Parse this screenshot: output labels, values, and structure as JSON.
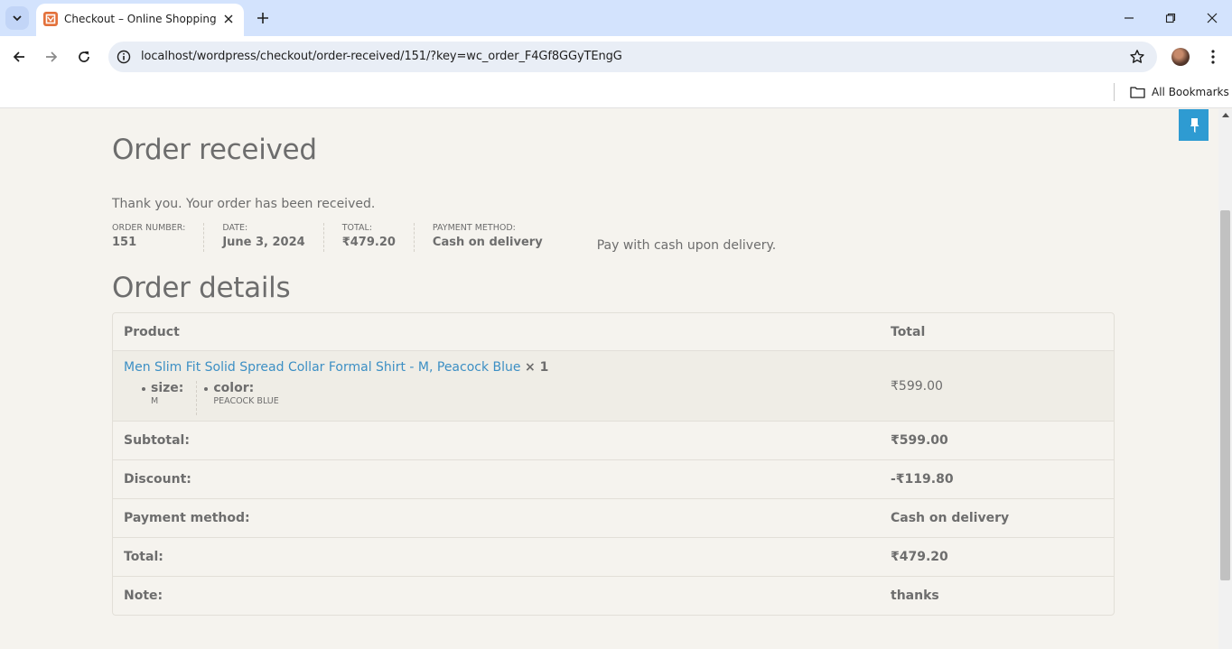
{
  "browser": {
    "tab_title": "Checkout – Online Shopping",
    "url": "localhost/wordpress/checkout/order-received/151/?key=wc_order_F4Gf8GGyTEngG",
    "bookmarks_label": "All Bookmarks"
  },
  "page": {
    "title": "Order received",
    "thanks": "Thank you. Your order has been received.",
    "overview": [
      {
        "label": "ORDER NUMBER:",
        "value": "151"
      },
      {
        "label": "DATE:",
        "value": "June 3, 2024"
      },
      {
        "label": "TOTAL:",
        "value": "₹479.20"
      },
      {
        "label": "PAYMENT METHOD:",
        "value": "Cash on delivery"
      }
    ],
    "payment_note": "Pay with cash upon delivery.",
    "details_title": "Order details"
  },
  "table": {
    "headers": {
      "product": "Product",
      "total": "Total"
    },
    "item": {
      "name": "Men Slim Fit Solid Spread Collar Formal Shirt - M, Peacock Blue",
      "qty": "× 1",
      "total": "₹599.00",
      "meta": [
        {
          "key": "size:",
          "value": "M"
        },
        {
          "key": "color:",
          "value": "PEACOCK BLUE"
        }
      ]
    },
    "footer": [
      {
        "label": "Subtotal:",
        "value": "₹599.00"
      },
      {
        "label": "Discount:",
        "value": "-₹119.80"
      },
      {
        "label": "Payment method:",
        "value": "Cash on delivery"
      },
      {
        "label": "Total:",
        "value": "₹479.20"
      },
      {
        "label": "Note:",
        "value": "thanks"
      }
    ]
  },
  "colors": {
    "tabbar": "#d3e3fd",
    "page_bg": "#f5f3ee",
    "link": "#3c8fc4",
    "text": "#6d6d6d",
    "pin_badge": "#2e9bd2"
  }
}
